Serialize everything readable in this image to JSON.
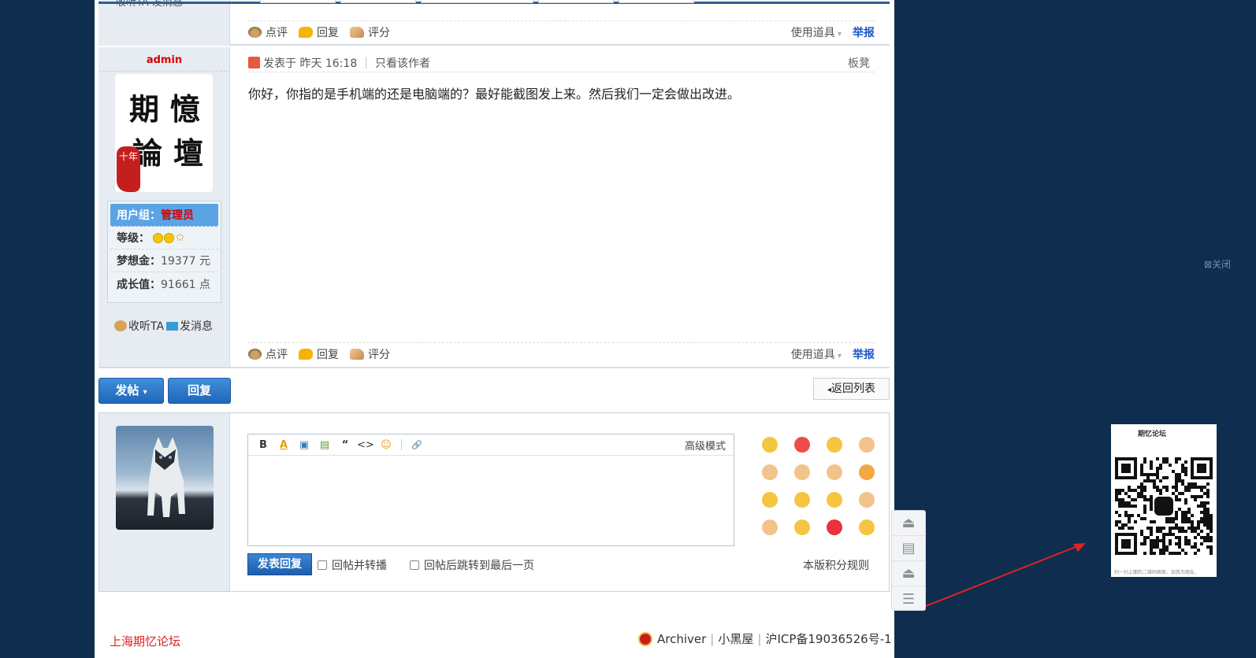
{
  "top_post": {
    "author_links_cut": "收听TA 发消息",
    "actions": {
      "comment": "点评",
      "reply": "回复",
      "rate": "评分",
      "use_tool": "使用道具",
      "report": "举报"
    }
  },
  "post": {
    "author": "admin",
    "avatar_text": [
      "期",
      "憶",
      "論",
      "壇"
    ],
    "avatar_seal": "十年",
    "posted_at": "发表于 昨天 16:18",
    "only_author": "只看该作者",
    "floor": "板凳",
    "content": "你好，你指的是手机端的还是电脑端的？最好能截图发上来。然后我们一定会做出改进。",
    "info": {
      "group_label": "用户组：",
      "group_value": "管理员",
      "level_label": "等级：",
      "dream_label": "梦想金：",
      "dream_value": "19377 元",
      "growth_label": "成长值：",
      "growth_value": "91661 点"
    },
    "follow": "收听TA",
    "message": "发消息",
    "actions": {
      "comment": "点评",
      "reply": "回复",
      "rate": "评分",
      "use_tool": "使用道具",
      "report": "举报"
    }
  },
  "buttons": {
    "new_post": "发帖",
    "reply": "回复",
    "back": "返回列表"
  },
  "reply_box": {
    "advanced": "高级模式",
    "submit": "发表回复",
    "opt_forward": "回帖并转播",
    "opt_jump": "回帖后跳转到最后一页",
    "rules": "本版积分规则",
    "toolbar": [
      "B",
      "A",
      "▣",
      "▤",
      "“",
      "<>",
      "☺",
      "🔗"
    ]
  },
  "emoji_colors": [
    "#f5c542",
    "#ef4b4b",
    "#f5c542",
    "#f2c38a",
    "#f2c38a",
    "#f2c38a",
    "#f2c38a",
    "#f5a742",
    "#f5c542",
    "#f5c542",
    "#f5c542",
    "#f2c38a",
    "#f2c38a",
    "#f5c542",
    "#e8323c",
    "#f5c542"
  ],
  "footer": {
    "site": "上海期忆论坛",
    "archiver": "Archiver",
    "blackroom": "小黑屋",
    "icp": "沪ICP备19036526号-1"
  },
  "floating": {
    "close": "关闭",
    "qr_title": "期忆论坛",
    "qr_caption": "扫一扫上面的二维码图案，加我为朋友。"
  },
  "colors": {
    "bg": "#0f2d4e",
    "accent": "#1f66b8",
    "admin": "#d60000",
    "report": "#1a57c6"
  }
}
